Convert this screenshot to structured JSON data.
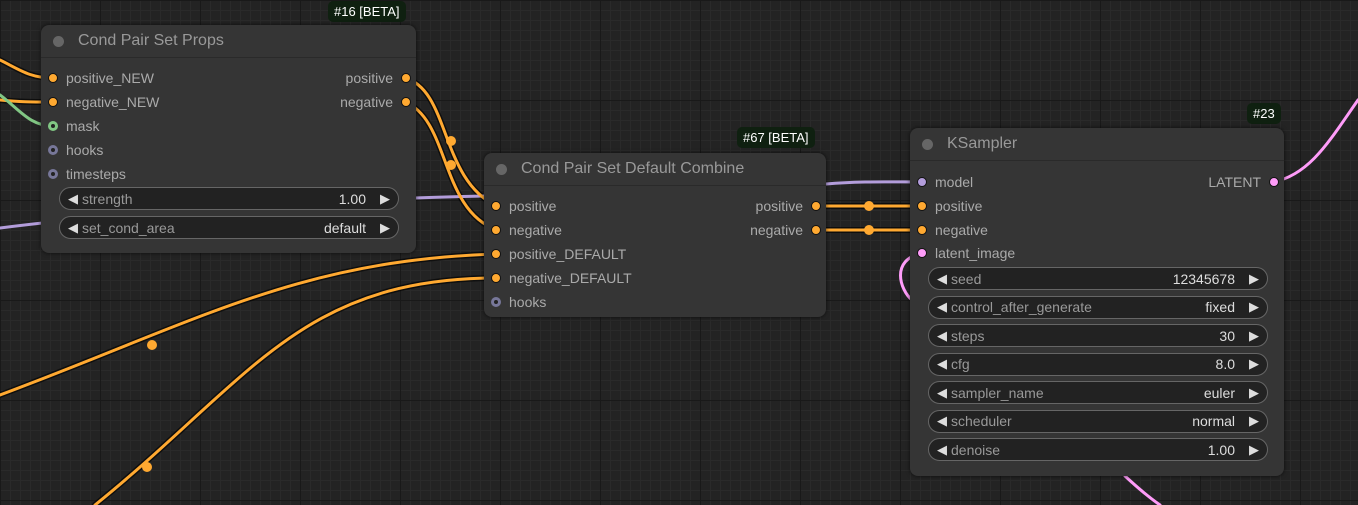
{
  "nodes": {
    "set_props": {
      "badge": "#16 [BETA]",
      "title": "Cond Pair Set Props",
      "inputs": [
        "positive_NEW",
        "negative_NEW",
        "mask",
        "hooks",
        "timesteps"
      ],
      "outputs": [
        "positive",
        "negative"
      ],
      "widgets": [
        {
          "label": "strength",
          "value": "1.00"
        },
        {
          "label": "set_cond_area",
          "value": "default"
        }
      ]
    },
    "default_combine": {
      "badge": "#67 [BETA]",
      "title": "Cond Pair Set Default Combine",
      "inputs": [
        "positive",
        "negative",
        "positive_DEFAULT",
        "negative_DEFAULT",
        "hooks"
      ],
      "outputs": [
        "positive",
        "negative"
      ]
    },
    "ksampler": {
      "badge": "#23",
      "title": "KSampler",
      "inputs": [
        "model",
        "positive",
        "negative",
        "latent_image"
      ],
      "outputs": [
        "LATENT"
      ],
      "widgets": [
        {
          "label": "seed",
          "value": "12345678"
        },
        {
          "label": "control_after_generate",
          "value": "fixed"
        },
        {
          "label": "steps",
          "value": "30"
        },
        {
          "label": "cfg",
          "value": "8.0"
        },
        {
          "label": "sampler_name",
          "value": "euler"
        },
        {
          "label": "scheduler",
          "value": "normal"
        },
        {
          "label": "denoise",
          "value": "1.00"
        }
      ]
    }
  },
  "colors": {
    "conditioning": "#ffa931",
    "mask": "#81c784",
    "hooks": "#777799",
    "model": "#b39ddb",
    "latent": "#ff9cf9"
  },
  "icons": {
    "left": "◀",
    "right": "▶"
  }
}
